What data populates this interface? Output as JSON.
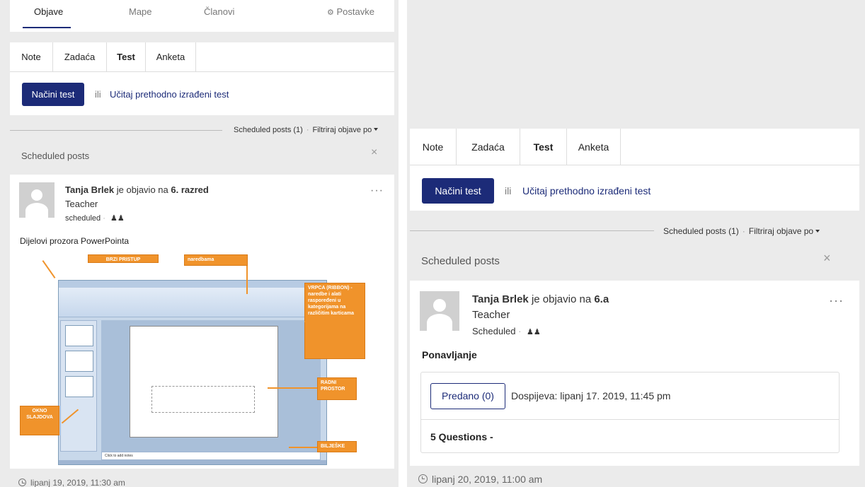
{
  "left": {
    "topnav": {
      "tabs": [
        "Objave",
        "Mape",
        "Članovi"
      ],
      "settings_label": "Postavke",
      "settings_icon": "gear-icon"
    },
    "composer": {
      "tabs": [
        "Note",
        "Zadaća",
        "Test",
        "Anketa"
      ],
      "primary_button": "Načini test",
      "or_text": "ili",
      "link_text": "Učitaj prethodno izrađeni test"
    },
    "filter": {
      "scheduled": "Scheduled posts (1)",
      "separator": "·",
      "filter_label": "Filtriraj objave po"
    },
    "scheduled_header": {
      "title": "Scheduled posts",
      "close": "×"
    },
    "post": {
      "author": "Tanja Brlek",
      "verb": "je objavio na",
      "target": "6. razred",
      "role": "Teacher",
      "status": "scheduled",
      "more": "···",
      "text": "Dijelovi prozora PowerPointa",
      "figure": {
        "callouts": {
          "quick_access": "BRZI PRISTUP",
          "commands": "naredbama",
          "ribbon": "VRPCA (RIBBON) - naredbe i alati raspoređeni u kategorijama na različitim karticama",
          "work_area": "RADNI PROSTOR",
          "slides_pane": "OKNO SLAJDOVA",
          "notes": "BILJEŠKE"
        },
        "notes_placeholder": "Click to add notes"
      },
      "timestamp": "lipanj 19, 2019, 11:30 am"
    }
  },
  "right": {
    "composer": {
      "tabs": [
        "Note",
        "Zadaća",
        "Test",
        "Anketa"
      ],
      "primary_button": "Načini test",
      "or_text": "ili",
      "link_text": "Učitaj prethodno izrađeni test"
    },
    "filter": {
      "scheduled": "Scheduled posts (1)",
      "separator": "·",
      "filter_label": "Filtriraj objave po"
    },
    "scheduled_header": {
      "title": "Scheduled posts",
      "close": "×"
    },
    "post": {
      "author": "Tanja Brlek",
      "verb": "je objavio na",
      "target": "6.a",
      "role": "Teacher",
      "status": "Scheduled",
      "more": "···",
      "heading": "Ponavljanje",
      "submitted_button": "Predano (0)",
      "due": "Dospijeva: lipanj 17. 2019, 11:45 pm",
      "questions": "5 Questions -",
      "timestamp": "lipanj 20, 2019, 11:00 am"
    }
  },
  "colors": {
    "brand": "#1c2b78",
    "callout": "#f0932b",
    "background": "#ebebeb"
  }
}
